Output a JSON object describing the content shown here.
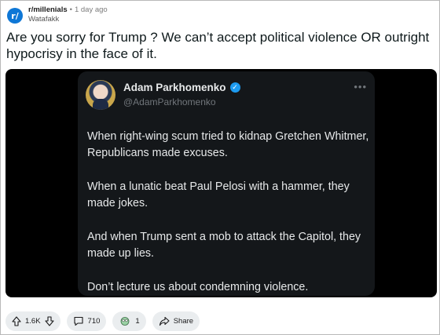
{
  "post": {
    "subreddit": "r/millenials",
    "separator": "•",
    "time": "1 day ago",
    "author": "Watafakk",
    "title": "Are you sorry for Trump ? We can’t accept political violence OR outright hypocrisy in the face of it.",
    "subreddit_icon_text": "r/"
  },
  "tweet": {
    "name": "Adam Parkhomenko",
    "handle": "@AdamParkhomenko",
    "verified_icon": "✓",
    "more_icon": "•••",
    "paragraphs": [
      "When right-wing scum tried to kidnap Gretchen Whitmer, Republicans made excuses.",
      "When a lunatic beat Paul Pelosi with a hammer, they made jokes.",
      "And when Trump sent a mob to attack the Capitol, they made up lies.",
      "Don’t lecture us about condemning violence."
    ]
  },
  "actions": {
    "votes": "1.6K",
    "comments": "710",
    "awards": "1",
    "share": "Share"
  },
  "colors": {
    "subreddit_icon": "#0e77d6",
    "tweet_bg": "#14171a",
    "verified": "#1d9bf0",
    "pill_bg": "#eaedef"
  }
}
